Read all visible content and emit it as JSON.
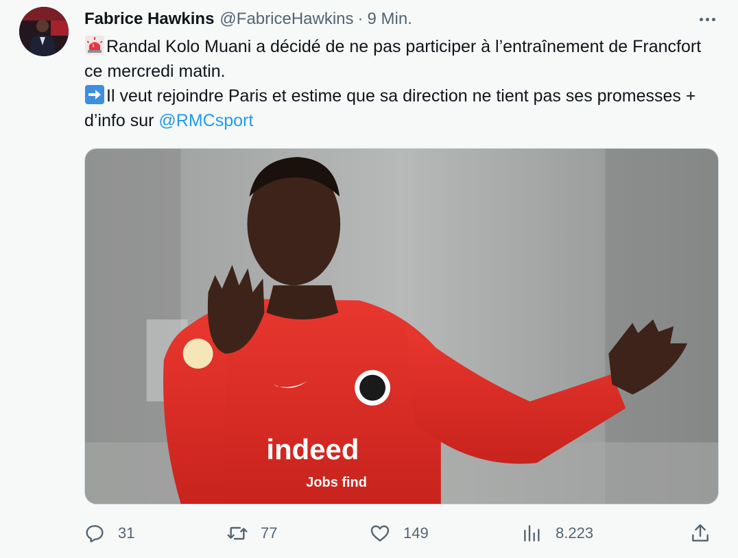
{
  "tweet": {
    "author_name": "Fabrice Hawkins",
    "author_handle": "@FabriceHawkins",
    "separator": "·",
    "time": "9 Min.",
    "line1_text": "Randal Kolo Muani a décidé de ne pas participer à l’entraînement de Francfort ce mercredi matin.",
    "line2_text": "Il veut rejoindre Paris et estime que sa direction ne tient pas ses promesses + d’info sur ",
    "mention": "@RMCsport",
    "line1_emoji": "rotating-light-emoji",
    "line2_emoji": "right-arrow-emoji"
  },
  "media": {
    "jersey_text": "indeed",
    "jersey_subtext": "Jobs find"
  },
  "actions": {
    "replies": "31",
    "retweets": "77",
    "likes": "149",
    "views": "8.223"
  },
  "icons": {
    "more": "more-icon",
    "reply": "reply-icon",
    "retweet": "retweet-icon",
    "like": "heart-icon",
    "views": "views-icon",
    "share": "share-icon"
  },
  "colors": {
    "background": "#f7f9f9",
    "text": "#0f1419",
    "secondary": "#536471",
    "link": "#1d9bf0"
  }
}
